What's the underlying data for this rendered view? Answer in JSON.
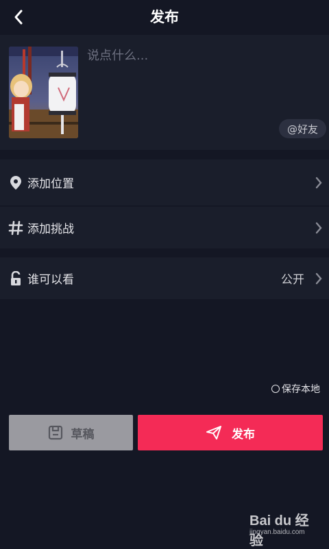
{
  "header": {
    "title": "发布"
  },
  "compose": {
    "placeholder": "说点什么...",
    "mention_label": "@好友"
  },
  "rows": {
    "location": {
      "label": "添加位置"
    },
    "challenge": {
      "label": "添加挑战"
    },
    "visibility": {
      "label": "谁可以看",
      "value": "公开"
    }
  },
  "save_local": {
    "label": "保存本地"
  },
  "actions": {
    "draft_label": "草稿",
    "publish_label": "发布"
  },
  "watermark": {
    "logo_text": "Bai du 经验",
    "url": "jingyan.baidu.com"
  },
  "colors": {
    "background": "#141724",
    "panel": "#1a1e2b",
    "accent": "#f42b56",
    "draft": "#9a9aa0"
  }
}
